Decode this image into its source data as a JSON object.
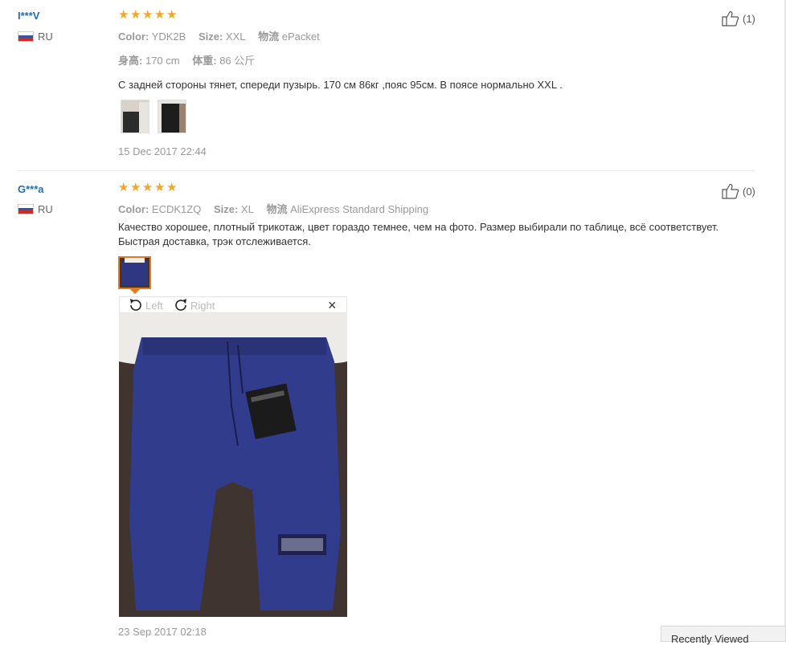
{
  "reviews": [
    {
      "username": "I***V",
      "country": "RU",
      "rating": 5,
      "likes": "(1)",
      "meta1": [
        {
          "label": "Color:",
          "value": "YDK2B"
        },
        {
          "label": "Size:",
          "value": "XXL"
        },
        {
          "label": "物流",
          "value": "ePacket"
        }
      ],
      "meta2": [
        {
          "label": "身高:",
          "value": "170 cm"
        },
        {
          "label": "体重:",
          "value": "86 公斤"
        }
      ],
      "text": "С задней стороны тянет, спереди пузырь. 170 см 86кг ,пояс 95см. В поясе нормально XXL .",
      "date": "15 Dec 2017 22:44"
    },
    {
      "username": "G***a",
      "country": "RU",
      "rating": 5,
      "likes": "(0)",
      "meta1": [
        {
          "label": "Color:",
          "value": "ECDK1ZQ"
        },
        {
          "label": "Size:",
          "value": "XL"
        },
        {
          "label": "物流",
          "value": "AliExpress Standard Shipping"
        }
      ],
      "text": "Качество хорошее, плотный трикотаж, цвет гораздо темнее, чем на фото. Размер выбирали по таблице, всё соответствует. Быстрая доставка, трэк отслеживается.",
      "date": "23 Sep 2017 02:18"
    }
  ],
  "viewer": {
    "rotate_left": "Left",
    "rotate_right": "Right",
    "close": "×"
  },
  "recently_viewed": "Recently Viewed",
  "colors": {
    "star": "#f5a623",
    "username": "#1f6fb7",
    "active_thumb": "#e07b23"
  }
}
